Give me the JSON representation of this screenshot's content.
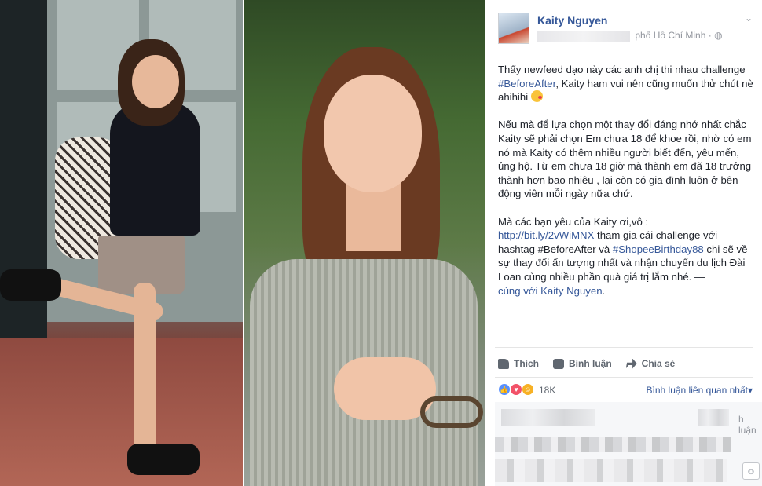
{
  "photos": {
    "left_alt": "",
    "right_alt": ""
  },
  "post": {
    "author": "Kaity Nguyen",
    "location": "phố Hồ Chí Minh",
    "globe_icon": "globe-icon",
    "menu_icon": "chevron-down-icon",
    "p1_a": "Thấy newfeed dạo này các anh chị thi nhau challenge ",
    "p1_tag": "#BeforeAfter",
    "p1_b": ", Kaity ham vui nên cũng muốn thử chút nè ahihihi",
    "p2": "Nếu mà để lựa chọn một thay đổi đáng nhớ nhất chắc Kaity sẽ phải chọn Em chưa 18 để khoe rồi, nhờ có em nó mà Kaity có thêm nhiều người biết đến, yêu mến, ủng hộ. Từ em chưa 18 giờ mà thành em đã 18 trưởng thành hơn bao nhiêu , lại còn có gia đình luôn ở bên động viên mỗi ngày nữa chứ.",
    "p3_a": "Mà các bạn yêu của Kaity ơi,vô :",
    "p3_link": "http://bit.ly/2vWiMNX",
    "p3_b": " tham gia cái challenge với hashtag #BeforeAfter và ",
    "p3_tag": "#ShopeeBirthday88",
    "p3_c": " chi sẽ về sự thay đổi ấn tượng nhất và nhận chuyến du lịch Đài Loan cùng nhiều phần quà giá trị lắm nhé. —",
    "p3_with": "cùng với",
    "p3_with_name": "Kaity Nguyen",
    "p3_end": "."
  },
  "actions": {
    "like": "Thích",
    "comment": "Bình luận",
    "share": "Chia sẻ"
  },
  "reactions": {
    "count": "18K",
    "sort_label": "Bình luận liên quan nhất",
    "sort_caret": "▾",
    "icons": [
      "like-icon",
      "love-icon",
      "haha-icon"
    ],
    "like_color": "#5890ff",
    "love_color": "#f25268",
    "haha_color": "#f7b125"
  },
  "comments": {
    "partial_text": "h luận"
  },
  "colors": {
    "link": "#365899",
    "text": "#1d2129",
    "meta": "#90949c"
  }
}
